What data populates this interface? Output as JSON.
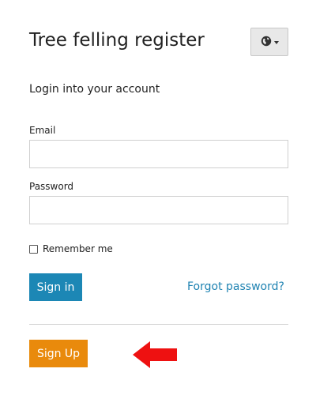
{
  "header": {
    "title": "Tree felling register",
    "subtitle": "Login into your account",
    "language_icon": "globe-icon"
  },
  "form": {
    "email_label": "Email",
    "email_value": "",
    "password_label": "Password",
    "password_value": "",
    "remember_label": "Remember me",
    "remember_checked": false,
    "signin_label": "Sign in",
    "forgot_label": "Forgot password?",
    "signup_label": "Sign Up"
  },
  "annotation": {
    "arrow_icon": "left-arrow-icon",
    "arrow_color": "#ee1111"
  },
  "colors": {
    "signin_button": "#1c87b5",
    "signup_button": "#e98a0c",
    "link": "#1f83b2"
  }
}
